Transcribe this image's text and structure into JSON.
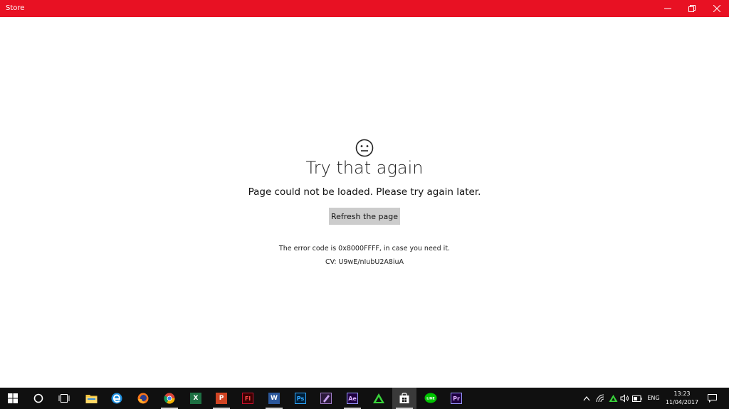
{
  "window": {
    "title": "Store"
  },
  "error_page": {
    "face_icon": "neutral-face-icon",
    "heading": "Try that again",
    "message": "Page could not be loaded. Please try again later.",
    "refresh_label": "Refresh the page",
    "error_code_text": "The error code is 0x8000FFFF, in case you need it.",
    "cv_text": "CV: U9wE/nIubU2A8iuA"
  },
  "taskbar": {
    "apps": [
      {
        "name": "file-explorer-icon"
      },
      {
        "name": "edge-icon"
      },
      {
        "name": "firefox-icon"
      },
      {
        "name": "chrome-icon"
      },
      {
        "name": "excel-icon",
        "letter": "X",
        "color": "#1d6f42"
      },
      {
        "name": "powerpoint-icon",
        "letter": "P",
        "color": "#d04423"
      },
      {
        "name": "flash-icon",
        "letter": "Fl",
        "color": "#c8102e"
      },
      {
        "name": "word-icon",
        "letter": "W",
        "color": "#2b579a"
      },
      {
        "name": "photoshop-icon",
        "letter": "Ps",
        "color": "#31a8ff"
      },
      {
        "name": "illustrator-draw-icon"
      },
      {
        "name": "after-effects-icon",
        "letter": "Ae",
        "color": "#9999ff"
      },
      {
        "name": "green-triangle-app-icon"
      },
      {
        "name": "store-icon"
      },
      {
        "name": "line-icon",
        "letter": "LINE",
        "color": "#00c300"
      },
      {
        "name": "premiere-icon",
        "letter": "Pr",
        "color": "#9999ff"
      }
    ],
    "language": "ENG",
    "time": "13:23",
    "date": "11/04/2017"
  },
  "colors": {
    "titlebar": "#e81123",
    "button_bg": "#cccccc",
    "taskbar": "#101010"
  }
}
